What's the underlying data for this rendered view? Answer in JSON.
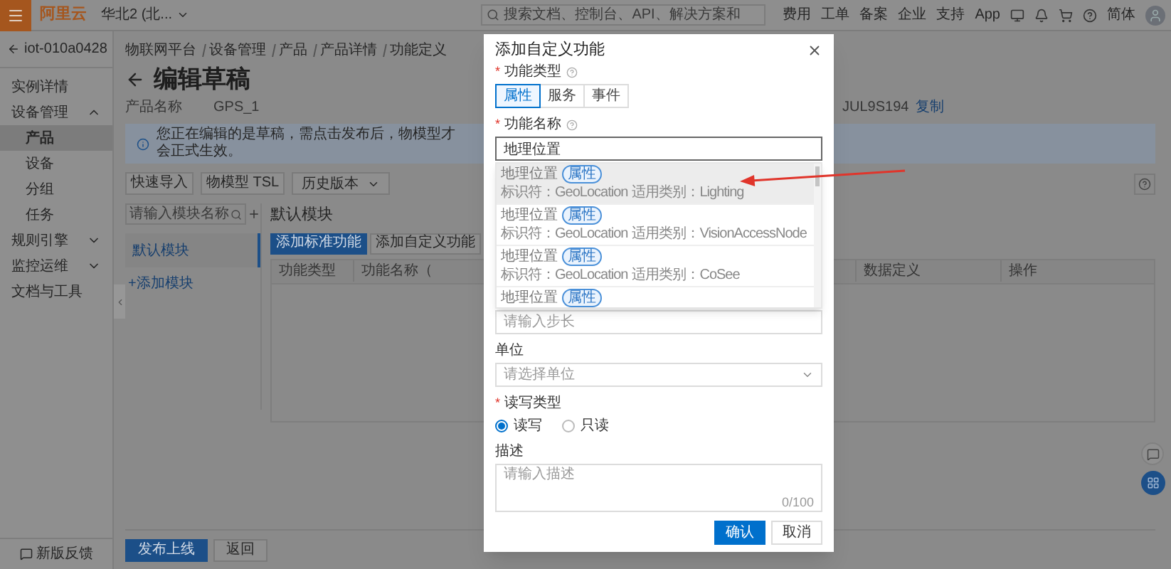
{
  "top_bar": {
    "logo": "阿里云",
    "region": "华北2 (北...",
    "search": {
      "placeholder": "搜索文档、控制台、API、解决方案和"
    },
    "nav": [
      "费用",
      "工单",
      "备案",
      "企业",
      "支持",
      "App"
    ],
    "language": "简体"
  },
  "sidebar": {
    "back": "iot-010a0428",
    "items": [
      {
        "label": "实例详情",
        "kind": "link",
        "selected": false
      },
      {
        "label": "设备管理",
        "kind": "group",
        "expanded": true,
        "children": [
          {
            "label": "产品",
            "selected": true
          },
          {
            "label": "设备",
            "selected": false
          },
          {
            "label": "分组",
            "selected": false
          },
          {
            "label": "任务",
            "selected": false
          }
        ]
      },
      {
        "label": "规则引擎",
        "kind": "group",
        "expanded": false
      },
      {
        "label": "监控运维",
        "kind": "group",
        "expanded": false
      },
      {
        "label": "文档与工具",
        "kind": "link",
        "selected": false
      }
    ],
    "feedback": "新版反馈"
  },
  "breadcrumb": [
    "物联网平台",
    "设备管理",
    "产品",
    "产品详情",
    "功能定义"
  ],
  "title": "编辑草稿",
  "product": {
    "label": "产品名称",
    "value": "GPS_1",
    "key": "JUL9S194",
    "copy": "复制"
  },
  "info": "您正在编辑的是草稿，需点击发布后，物模型才会正式生效。",
  "toolbar": [
    {
      "label": "快速导入",
      "kind": "button"
    },
    {
      "label": "物模型 TSL",
      "kind": "button"
    },
    {
      "label": "历史版本",
      "kind": "dropdown"
    }
  ],
  "modules": {
    "search": {
      "placeholder": "请输入模块名称"
    },
    "items": [
      {
        "label": "默认模块",
        "selected": true
      }
    ],
    "add": "+添加模块"
  },
  "content": {
    "heading": "默认模块",
    "actions": [
      {
        "label": "添加标准功能",
        "primary": true
      },
      {
        "label": "添加自定义功能",
        "primary": false
      }
    ],
    "columns": [
      "功能类型",
      "功能名称（",
      "数据定义",
      "操作"
    ]
  },
  "footer": [
    {
      "label": "发布上线",
      "primary": true
    },
    {
      "label": "返回",
      "primary": false
    }
  ],
  "dialog": {
    "title": "添加自定义功能",
    "type_field": {
      "mark": "*",
      "label": "功能类型",
      "options": [
        {
          "label": "属性",
          "selected": true
        },
        {
          "label": "服务",
          "selected": false
        },
        {
          "label": "事件",
          "selected": false
        }
      ]
    },
    "name_field": {
      "mark": "*",
      "label": "功能名称",
      "value": "地理位置"
    },
    "suggestions": [
      {
        "name": "地理位置",
        "tag": "属性",
        "identifier": "标识符：GeoLocation",
        "category": "适用类别：Lighting",
        "selected": true
      },
      {
        "name": "地理位置",
        "tag": "属性",
        "identifier": "标识符：GeoLocation",
        "category": "适用类别：VisionAccessNode",
        "selected": false
      },
      {
        "name": "地理位置",
        "tag": "属性",
        "identifier": "标识符：GeoLocation",
        "category": "适用类别：CoSee",
        "selected": false
      },
      {
        "name": "地理位置",
        "tag": "属性",
        "selected": false
      }
    ],
    "step": {
      "placeholder": "请输入步长"
    },
    "unit_field": {
      "label": "单位",
      "placeholder": "请选择单位"
    },
    "rw_field": {
      "mark": "*",
      "label": "读写类型",
      "options": [
        {
          "label": "读写",
          "selected": true
        },
        {
          "label": "只读",
          "selected": false
        }
      ]
    },
    "desc_field": {
      "label": "描述",
      "placeholder": "请输入描述",
      "count": "0/100"
    },
    "confirm": "确认",
    "cancel": "取消"
  }
}
